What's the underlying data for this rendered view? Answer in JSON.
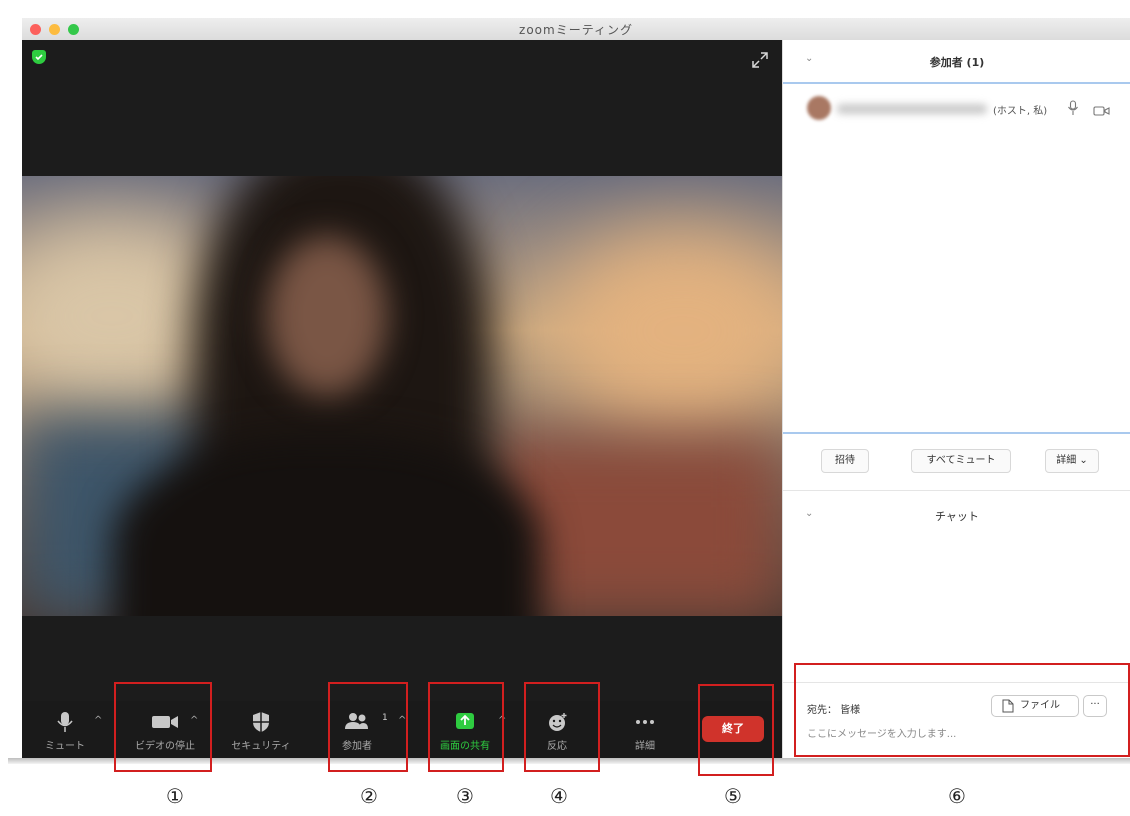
{
  "window": {
    "title": "zoomミーティング"
  },
  "toolbar": {
    "mute": "ミュート",
    "stop_video": "ビデオの停止",
    "security": "セキュリティ",
    "participants": "参加者",
    "participants_count": "1",
    "share_screen": "画面の共有",
    "reactions": "反応",
    "more": "詳細",
    "end": "終了"
  },
  "participants_panel": {
    "title": "参加者 (1)",
    "participant_role": "(ホスト, 私)",
    "buttons": {
      "invite": "招待",
      "mute_all": "すべてミュート",
      "more": "詳細"
    }
  },
  "chat_panel": {
    "title": "チャット",
    "to_label": "宛先： 皆様",
    "file_button": "ファイル",
    "more_button": "···",
    "input_placeholder": "ここにメッセージを入力します..."
  },
  "annotations": [
    "①",
    "②",
    "③",
    "④",
    "⑤",
    "⑥"
  ],
  "colors": {
    "end_button": "#d0332b",
    "share_button": "#2ecc40",
    "annotation_box": "#d21f1f",
    "panel_divider": "#a9c9ee"
  }
}
